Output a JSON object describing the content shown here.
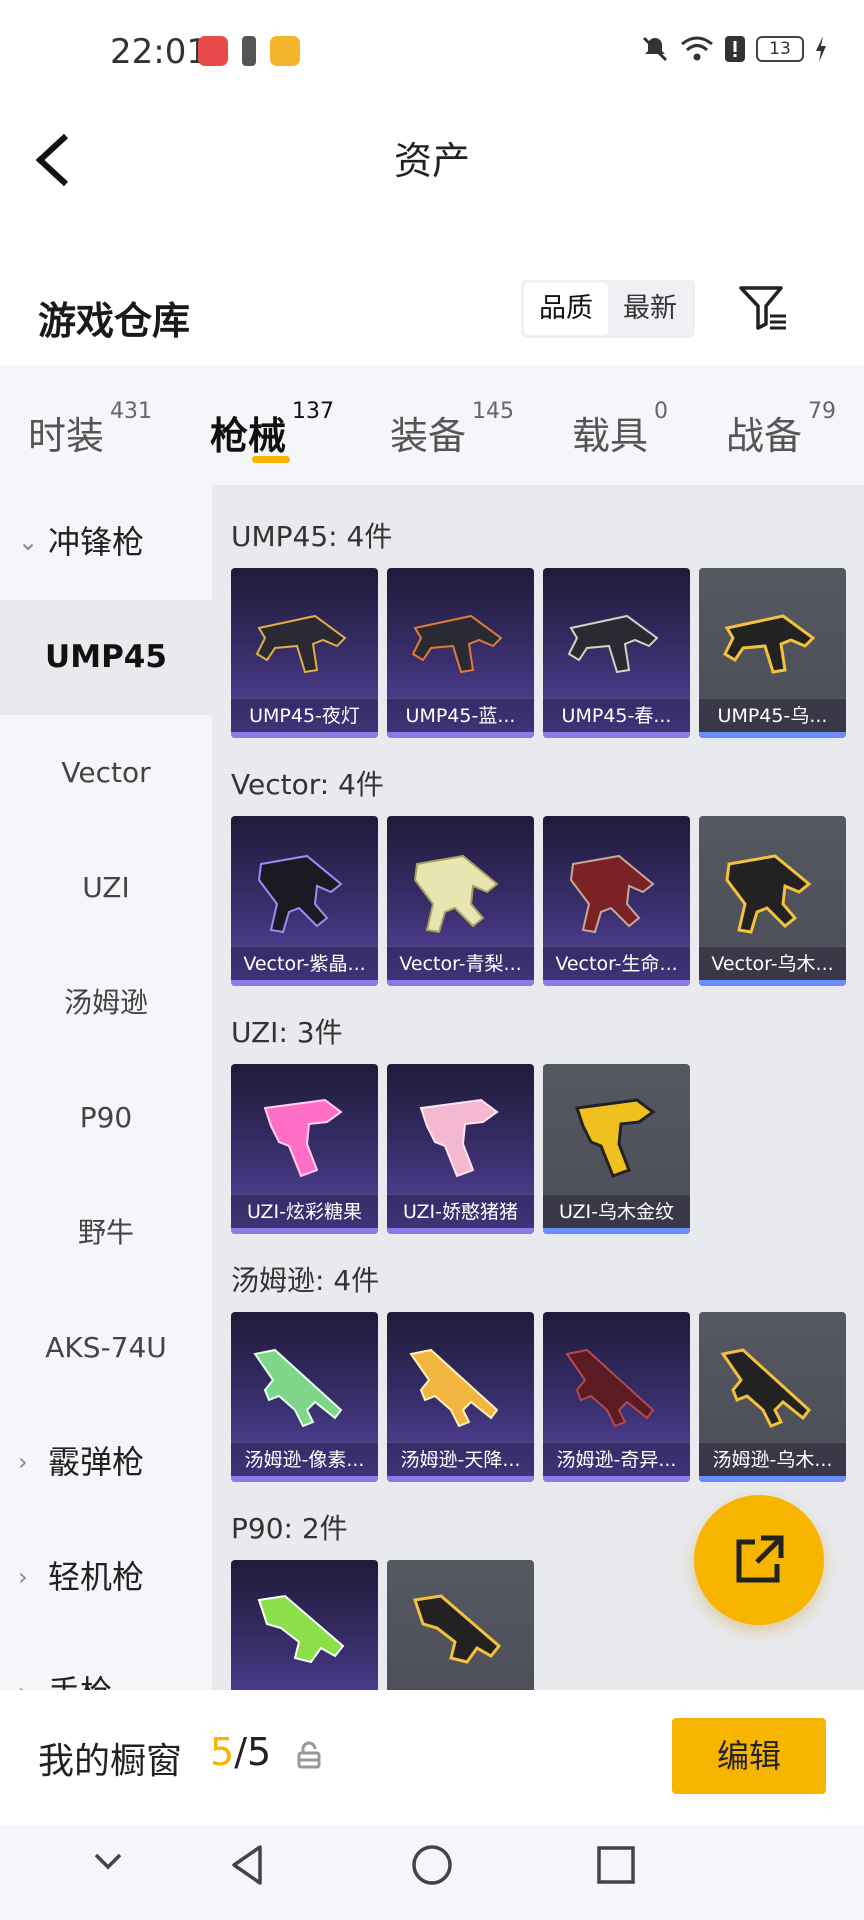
{
  "status_bar": {
    "time": "22:01",
    "battery": "13"
  },
  "header": {
    "title": "资产",
    "section_title": "游戏仓库",
    "sort_options": [
      "品质",
      "最新"
    ],
    "sort_selected": "品质"
  },
  "tabs": [
    {
      "label": "时装",
      "count": "431"
    },
    {
      "label": "枪械",
      "count": "137",
      "active": true
    },
    {
      "label": "装备",
      "count": "145"
    },
    {
      "label": "载具",
      "count": "0"
    },
    {
      "label": "战备",
      "count": "79"
    }
  ],
  "sidebar": {
    "groups": [
      "冲锋枪",
      "霰弹枪",
      "轻机枪",
      "手枪"
    ],
    "items": [
      "UMP45",
      "Vector",
      "UZI",
      "汤姆逊",
      "P90",
      "野牛",
      "AKS-74U"
    ],
    "selected": "UMP45"
  },
  "content": {
    "groups": [
      {
        "label": "UMP45: 4件",
        "items": [
          "UMP45-夜灯",
          "UMP45-蓝...",
          "UMP45-春...",
          "UMP45-乌..."
        ]
      },
      {
        "label": "Vector: 4件",
        "items": [
          "Vector-紫晶...",
          "Vector-青梨...",
          "Vector-生命...",
          "Vector-乌木..."
        ]
      },
      {
        "label": "UZI: 3件",
        "items": [
          "UZI-炫彩糖果",
          "UZI-娇憨猪猪",
          "UZI-乌木金纹"
        ]
      },
      {
        "label": "汤姆逊: 4件",
        "items": [
          "汤姆逊-像素...",
          "汤姆逊-天降...",
          "汤姆逊-奇异...",
          "汤姆逊-乌木..."
        ]
      },
      {
        "label": "P90: 2件",
        "items": [
          "",
          ""
        ]
      }
    ]
  },
  "bottom_bar": {
    "window_label": "我的橱窗",
    "window_current": "5",
    "window_total": "/5",
    "edit_label": "编辑"
  },
  "colors": {
    "accent": "#f7b500",
    "card_purple": "#3a2f6e",
    "card_gold": "#4b4d57"
  }
}
